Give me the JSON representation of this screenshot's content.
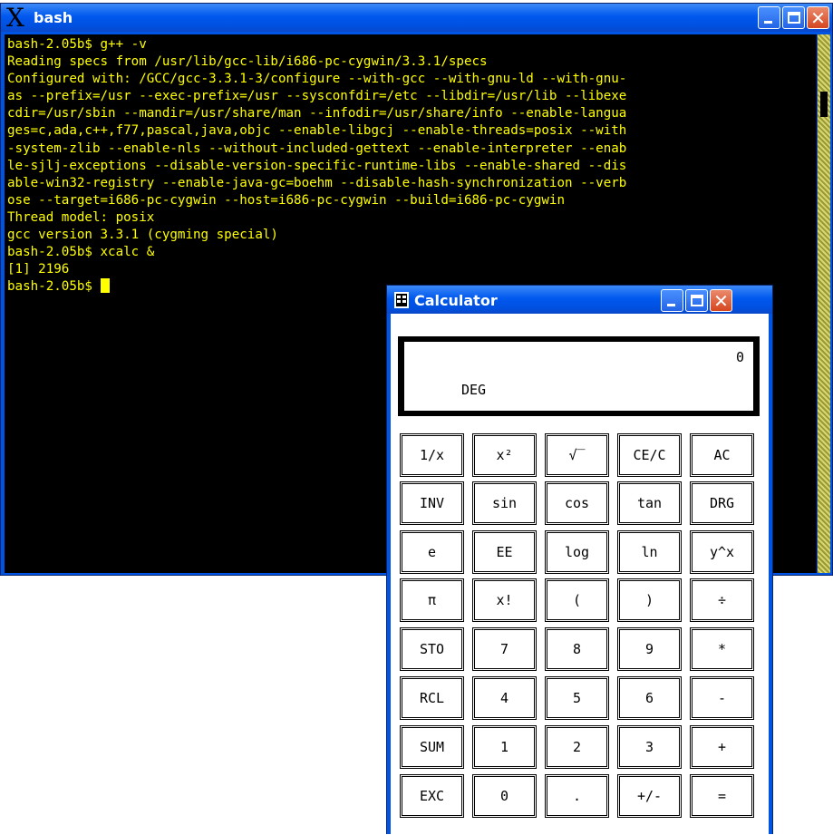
{
  "bash": {
    "title": "bash",
    "title_icon": "X",
    "title_icon_name": "x-window-icon",
    "terminal_text": "bash-2.05b$ g++ -v\nReading specs from /usr/lib/gcc-lib/i686-pc-cygwin/3.3.1/specs\nConfigured with: /GCC/gcc-3.3.1-3/configure --with-gcc --with-gnu-ld --with-gnu-\nas --prefix=/usr --exec-prefix=/usr --sysconfdir=/etc --libdir=/usr/lib --libexe\ncdir=/usr/sbin --mandir=/usr/share/man --infodir=/usr/share/info --enable-langua\nges=c,ada,c++,f77,pascal,java,objc --enable-libgcj --enable-threads=posix --with\n-system-zlib --enable-nls --without-included-gettext --enable-interpreter --enab\nle-sjlj-exceptions --disable-version-specific-runtime-libs --enable-shared --dis\nable-win32-registry --enable-java-gc=boehm --disable-hash-synchronization --verb\nose --target=i686-pc-cygwin --host=i686-pc-cygwin --build=i686-pc-cygwin\nThread model: posix\ngcc version 3.3.1 (cygming special)\nbash-2.05b$ xcalc &\n[1] 2196\nbash-2.05b$ ",
    "colors": {
      "text": "#ffff00",
      "background": "#000000"
    }
  },
  "calculator": {
    "title": "Calculator",
    "display": {
      "value": "0",
      "mode": "DEG"
    },
    "keys": [
      [
        "1/x",
        "x²",
        "√‾",
        "CE/C",
        "AC"
      ],
      [
        "INV",
        "sin",
        "cos",
        "tan",
        "DRG"
      ],
      [
        "e",
        "EE",
        "log",
        "ln",
        "y^x"
      ],
      [
        "π",
        "x!",
        "(",
        ")",
        "÷"
      ],
      [
        "STO",
        "7",
        "8",
        "9",
        "*"
      ],
      [
        "RCL",
        "4",
        "5",
        "6",
        "-"
      ],
      [
        "SUM",
        "1",
        "2",
        "3",
        "+"
      ],
      [
        "EXC",
        "0",
        ".",
        "+/-",
        "="
      ]
    ]
  },
  "window_controls": {
    "minimize": "minimize-icon",
    "maximize": "maximize-icon",
    "close": "close-icon"
  },
  "colors": {
    "titlebar": "#0058ee",
    "close_button": "#d5461f",
    "scrollbar": "#b8b850"
  }
}
